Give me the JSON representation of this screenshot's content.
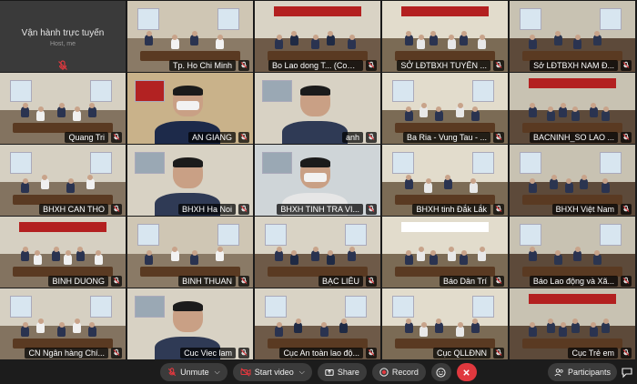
{
  "self_tile": {
    "title": "Vận hành trực tuyến",
    "subtitle": "Host, me"
  },
  "tiles": [
    {
      "name": "Tp. Ho Chi Minh",
      "scene": "room",
      "active": true
    },
    {
      "name": "Bo Lao dong T... (Cohost)",
      "scene": "stage"
    },
    {
      "name": "SỞ LĐTBXH TUYÊN ...",
      "scene": "room"
    },
    {
      "name": "Sở LĐTBXH NAM Đ...",
      "scene": "room"
    },
    {
      "name": "Quang Tri",
      "scene": "room"
    },
    {
      "name": "AN GIANG",
      "scene": "closeup-red"
    },
    {
      "name": "anh",
      "scene": "closeup"
    },
    {
      "name": "Ba Ria - Vung Tau - ...",
      "scene": "room"
    },
    {
      "name": "BACNINH_SO LAO ...",
      "scene": "room"
    },
    {
      "name": "BHXH CAN THO",
      "scene": "room"
    },
    {
      "name": "BHXH Ha Noi",
      "scene": "closeup"
    },
    {
      "name": "BHXH TINH TRA VI...",
      "scene": "closeup-blue"
    },
    {
      "name": "BHXH tinh Đắk Lắk",
      "scene": "room"
    },
    {
      "name": "BHXH Việt Nam",
      "scene": "room"
    },
    {
      "name": "BINH DUONG",
      "scene": "room"
    },
    {
      "name": "BINH THUAN",
      "scene": "room"
    },
    {
      "name": "BẠC LIÊU",
      "scene": "room"
    },
    {
      "name": "Báo Dân Trí",
      "scene": "stage-red"
    },
    {
      "name": "Báo Lao động và Xã...",
      "scene": "room"
    },
    {
      "name": "CN Ngân hàng Chí...",
      "scene": "room"
    },
    {
      "name": "Cuc Viec lam",
      "scene": "closeup"
    },
    {
      "name": "Cục An toàn lao độ...",
      "scene": "room"
    },
    {
      "name": "Cục QLLĐNN",
      "scene": "room"
    },
    {
      "name": "Cục Trẻ em",
      "scene": "room"
    }
  ],
  "toolbar": {
    "unmute": "Unmute",
    "start_video": "Start video",
    "share": "Share",
    "record": "Record",
    "participants": "Participants"
  },
  "colors": {
    "active_border": "#2f7cf6",
    "end_call": "#e0383e",
    "muted_icon": "#e0383e"
  }
}
